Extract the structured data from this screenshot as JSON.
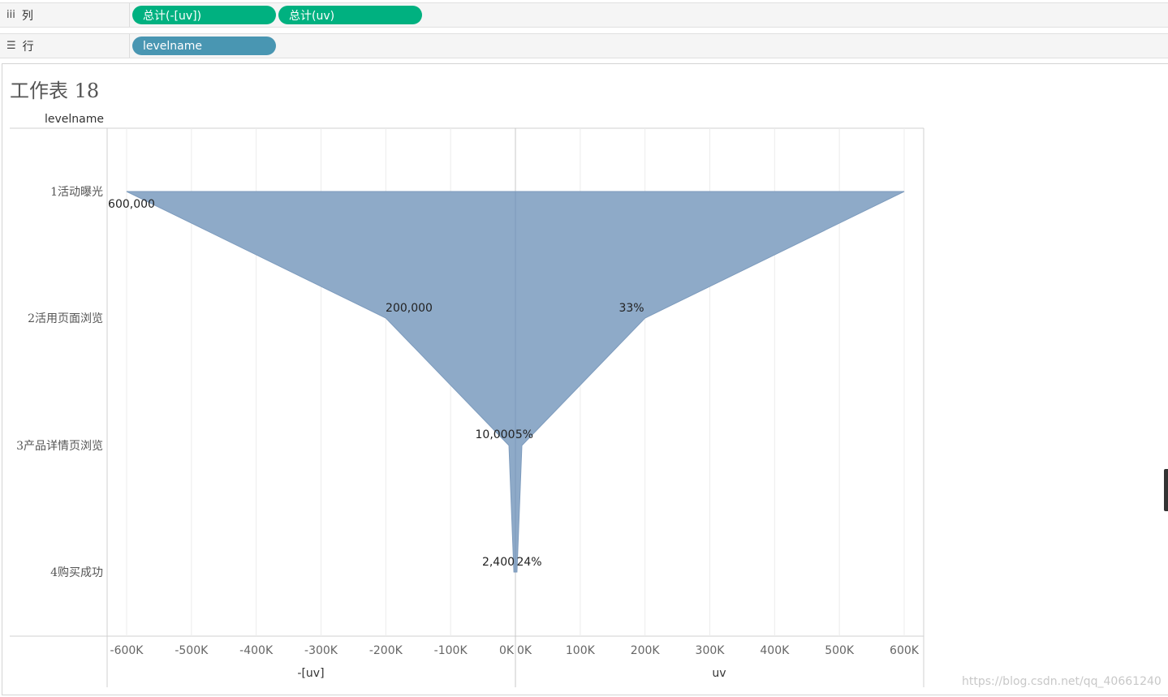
{
  "shelves": {
    "columns": {
      "label": "列",
      "icon": "columns-icon",
      "pills": [
        "总计(-[uv])",
        "总计(uv)"
      ]
    },
    "rows": {
      "label": "行",
      "icon": "rows-icon",
      "pills": [
        "levelname"
      ]
    }
  },
  "sheet": {
    "title": "工作表 18",
    "row_header": "levelname"
  },
  "colors": {
    "area": "#8eaac8",
    "area_stroke": "#7d9bbd",
    "pill_green": "#00b180",
    "pill_blue": "#4996b2"
  },
  "watermark": "https://blog.csdn.net/qq_40661240",
  "chart_data": {
    "type": "area",
    "orientation": "horizontal-funnel",
    "categories": [
      "1活动曝光",
      "2活用页面浏览",
      "3产品详情页浏览",
      "4购买成功"
    ],
    "series": [
      {
        "name": "-[uv]",
        "values": [
          -600000,
          -200000,
          -10000,
          -2400
        ]
      },
      {
        "name": "uv",
        "values": [
          600000,
          200000,
          10000,
          2400
        ]
      }
    ],
    "left_axis": {
      "title": "-[uv]",
      "range": [
        -630000,
        0
      ],
      "ticks": [
        "-600K",
        "-500K",
        "-400K",
        "-300K",
        "-200K",
        "-100K",
        "0K"
      ],
      "tick_values": [
        -600000,
        -500000,
        -400000,
        -300000,
        -200000,
        -100000,
        0
      ]
    },
    "right_axis": {
      "title": "uv",
      "range": [
        0,
        630000
      ],
      "ticks": [
        "0K",
        "100K",
        "200K",
        "300K",
        "400K",
        "500K",
        "600K"
      ],
      "tick_values": [
        0,
        100000,
        200000,
        300000,
        400000,
        500000,
        600000
      ]
    },
    "left_labels": [
      "600,000",
      "200,000",
      "10,000",
      "2,400"
    ],
    "right_labels": [
      "",
      "33%",
      "5%",
      "24%"
    ],
    "grid": true
  }
}
